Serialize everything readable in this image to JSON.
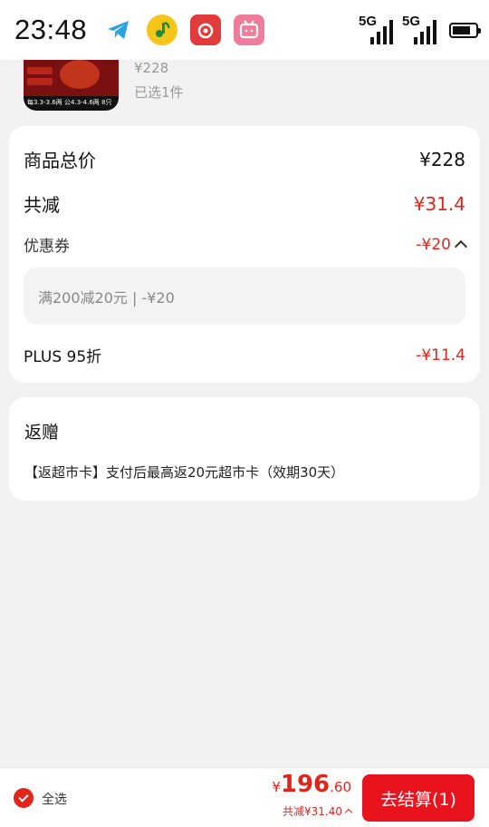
{
  "status_bar": {
    "time": "23:48",
    "apps": [
      {
        "icon": "telegram-icon",
        "color": "#2aa3e0"
      },
      {
        "icon": "qq-music-icon",
        "color": "#f5c518"
      },
      {
        "icon": "netease-music-icon",
        "color": "#e13b3b"
      },
      {
        "icon": "bilibili-icon",
        "color": "#f07c9c"
      }
    ],
    "signal_1_label": "5G",
    "signal_2_label": "5G"
  },
  "product": {
    "price": "¥228",
    "selected_count": "已选1件",
    "thumb_caption": "每3.3-3.6两 公4.3-4.6两 8只"
  },
  "summary": {
    "total_label": "商品总价",
    "total_value": "¥228",
    "discount_label": "共减",
    "discount_value": "¥31.4",
    "coupon_label": "优惠券",
    "coupon_value": "-¥20",
    "coupon_detail": "满200减20元 | -¥20",
    "plus_label": "PLUS 95折",
    "plus_value": "-¥11.4"
  },
  "gift": {
    "title": "返赠",
    "description": "【返超市卡】支付后最高返20元超市卡（效期30天）"
  },
  "bottom_bar": {
    "select_all_label": "全选",
    "currency": "¥",
    "total_integer": "196",
    "total_decimal": ".60",
    "saved_text": "共减¥31.40",
    "checkout_label": "去结算(1)"
  },
  "colors": {
    "accent_red": "#e1251b",
    "button_red": "#e9131e",
    "background": "#f2f2f2"
  }
}
